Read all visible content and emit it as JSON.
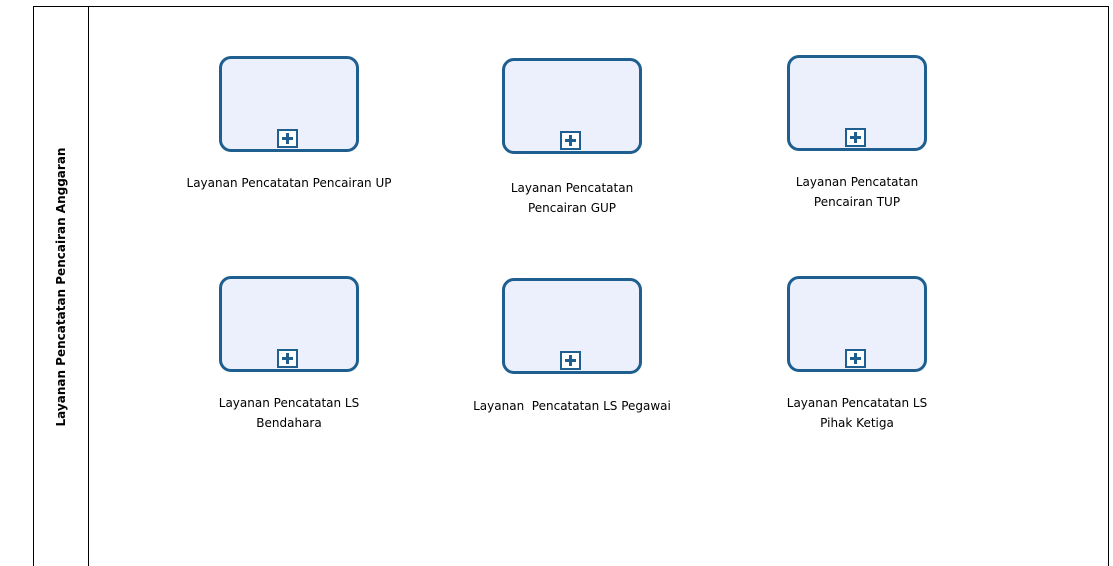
{
  "lane": {
    "title": "Layanan Pencatatan Pencairan Anggaran"
  },
  "tasks": [
    {
      "label": "Layanan Pencatatan Pencairan UP"
    },
    {
      "label": "Layanan Pencatatan Pencairan GUP"
    },
    {
      "label": "Layanan Pencatatan Pencairan TUP"
    },
    {
      "label": "Layanan Pencatatan LS Bendahara"
    },
    {
      "label": "Layanan  Pencatatan LS Pegawai"
    },
    {
      "label": "Layanan Pencatatan LS Pihak Ketiga"
    }
  ],
  "colors": {
    "task_border": "#1f5f8f",
    "task_fill": "#ecf0fc",
    "line": "#000000"
  },
  "icons": {
    "subprocess_marker": "plus-icon"
  }
}
